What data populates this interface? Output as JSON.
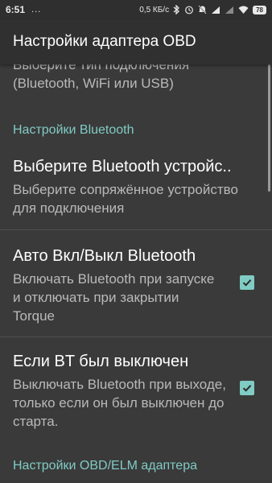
{
  "status_bar": {
    "time": "6:51",
    "dots": "...",
    "speed": "0,5 КБ/с",
    "battery": "78"
  },
  "app_bar": {
    "title": "Настройки адаптера OBD"
  },
  "connection_type": {
    "summary": "Выберите тип подключения (Bluetooth, WiFi или USB)"
  },
  "bluetooth_category": {
    "title": "Настройки Bluetooth"
  },
  "select_device": {
    "title": "Выберите Bluetooth устройс..",
    "summary": "Выберите сопряжённое устройство для подключения"
  },
  "auto_bluetooth": {
    "title": "Авто Вкл/Выкл Bluetooth",
    "summary": "Включать Bluetooth при запуске и отключать при закрытии Torque",
    "checked": true
  },
  "bt_was_off": {
    "title": "Если BT был выключен",
    "summary": "Выключать Bluetooth при выходе, только если он был выключен до старта.",
    "checked": true
  },
  "obd_category": {
    "title": "Настройки OBD/ELM адаптера"
  },
  "colors": {
    "accent": "#80cbc4",
    "background": "#3a3a3a",
    "appbar": "#303030",
    "text_primary": "#ffffff",
    "text_secondary": "#b9b9b9"
  }
}
